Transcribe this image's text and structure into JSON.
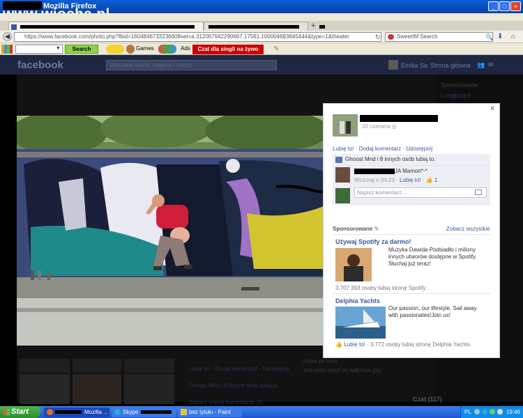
{
  "watermark": "www.wiocha.pl",
  "window": {
    "title": "Mozilla Firefox",
    "minimize": "_",
    "maximize": "□",
    "close": "×"
  },
  "browser": {
    "url": "https://www.facebook.com/photo.php?fbid=1604846733236608set=a.312067942290667.17561.100004683845444&type=1&theater",
    "search_engine": "SweetIM Search",
    "toolbar": {
      "search_label": "Search",
      "games_label": "Games",
      "ads_label": "Ads",
      "promo_label": "Czat dla singli na żywo"
    }
  },
  "facebook": {
    "logo": "facebook",
    "search_placeholder": "Wyszukaj osoby, miejsca i rzeczy",
    "user_nav": "Emilia Sa",
    "home_nav": "Strona główna",
    "photo_panel": {
      "date": "20 czerwca",
      "actions": "Lubię to! · Dodaj komentarz · Udostępnij",
      "likes": "Ghoost Mnd i 8 innych osób lubią to.",
      "comment": {
        "text": "JA Mamon*-*",
        "meta_time": "Wczoraj o 04:23 ·",
        "meta_like": "Lubię to! ·",
        "like_count": "1"
      },
      "comment_placeholder": "Napisz komentarz..."
    },
    "sponsored": {
      "label": "Sponsorowane",
      "see_all": "Zobacz wszystkie",
      "ads": [
        {
          "title": "Używaj Spotify za darmo!",
          "body": "Muzyka Dawida Podsiadło i miliony innych utworów dostępne w Spotify. Słuchaj już teraz!",
          "meta": "3.707.393 osoby lubią stronę Spotify."
        },
        {
          "title": "Delphia Yachts",
          "body": "Our passion, our lifestyle. Sail away with passionates!Join us!",
          "meta_like": "Lubię to!",
          "meta": "· 3.772 osoby lubią stronę Delphia Yachts."
        }
      ]
    },
    "background": {
      "sponsor_label": "Sponsorowane",
      "ad_title": "Longboard",
      "comments": [
        "Lubię to! · Dodaj komentarz · Udostępnij",
        "Ghoost Mnd i 8 innych osób lubią to.",
        "Zobacz więcej komentarzy (2)"
      ],
      "message_lines": [
        "make pir bum",
        "and write heart on wall how gay"
      ],
      "chat": "Czat (117)"
    }
  },
  "taskbar": {
    "start": "Start",
    "tasks": [
      "Mozilla ...",
      "Skype",
      "bez tytułu - Paint"
    ],
    "lang": "PL",
    "clock": "19:46"
  }
}
